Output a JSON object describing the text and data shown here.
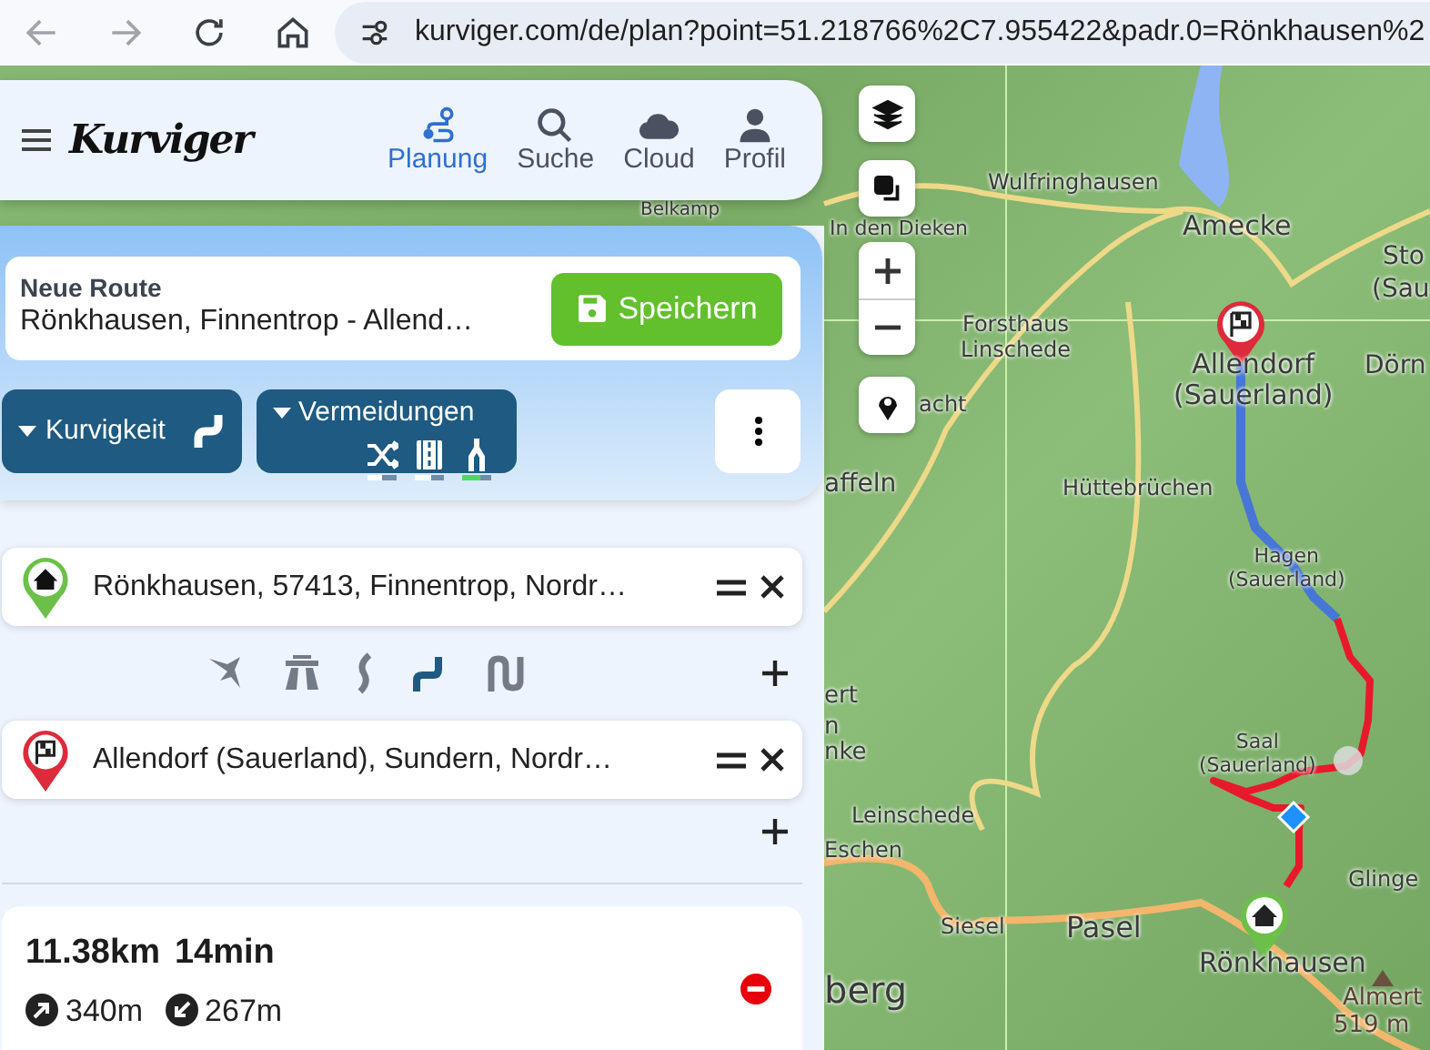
{
  "browser": {
    "url": "kurviger.com/de/plan?point=51.218766%2C7.955422&padr.0=Rönkhausen%2"
  },
  "header": {
    "logo": "Kurviger",
    "nav": [
      {
        "label": "Planung",
        "selected": true
      },
      {
        "label": "Suche",
        "selected": false
      },
      {
        "label": "Cloud",
        "selected": false
      },
      {
        "label": "Profil",
        "selected": false
      }
    ]
  },
  "route": {
    "caption": "Neue Route",
    "name": "Rönkhausen, Finnentrop - Allend…",
    "save_button": "Speichern",
    "curviness_button": "Kurvigkeit",
    "avoid_button": "Vermeidungen",
    "avoid_options": [
      {
        "level": 0.5,
        "color": "#ffffff"
      },
      {
        "level": 0.55,
        "color": "#ffffff"
      },
      {
        "level": 0.65,
        "color": "#4cd964"
      }
    ]
  },
  "waypoints": [
    {
      "kind": "start",
      "text": "Rönkhausen, 57413, Finnentrop, Nordr…"
    },
    {
      "kind": "finish",
      "text": "Allendorf (Sauerland), Sundern, Nordr…"
    }
  ],
  "profiles": [
    {
      "selected": false
    },
    {
      "selected": false
    },
    {
      "selected": false
    },
    {
      "selected": true
    },
    {
      "selected": false
    }
  ],
  "summary": {
    "distance": "11.38km",
    "duration": "14min",
    "ascent": "340m",
    "descent": "267m"
  },
  "map": {
    "labels": [
      "Belkamp",
      "Wulfringhausen",
      "Amecke",
      "Sto",
      "(Sau",
      "In den Dieken",
      "Forsthaus Linschede",
      "Allendorf (Sauerland)",
      "Dörn",
      "acht",
      "affeln",
      "Hüttebrüchen",
      "Hagen (Sauerland)",
      "ert",
      "n",
      "nke",
      "Saal (Sauerland)",
      "Leinschede",
      "Eschen",
      "Glinge",
      "Siesel",
      "Pasel",
      "Rönkhausen",
      "berg",
      "Almert",
      "519 m"
    ]
  }
}
